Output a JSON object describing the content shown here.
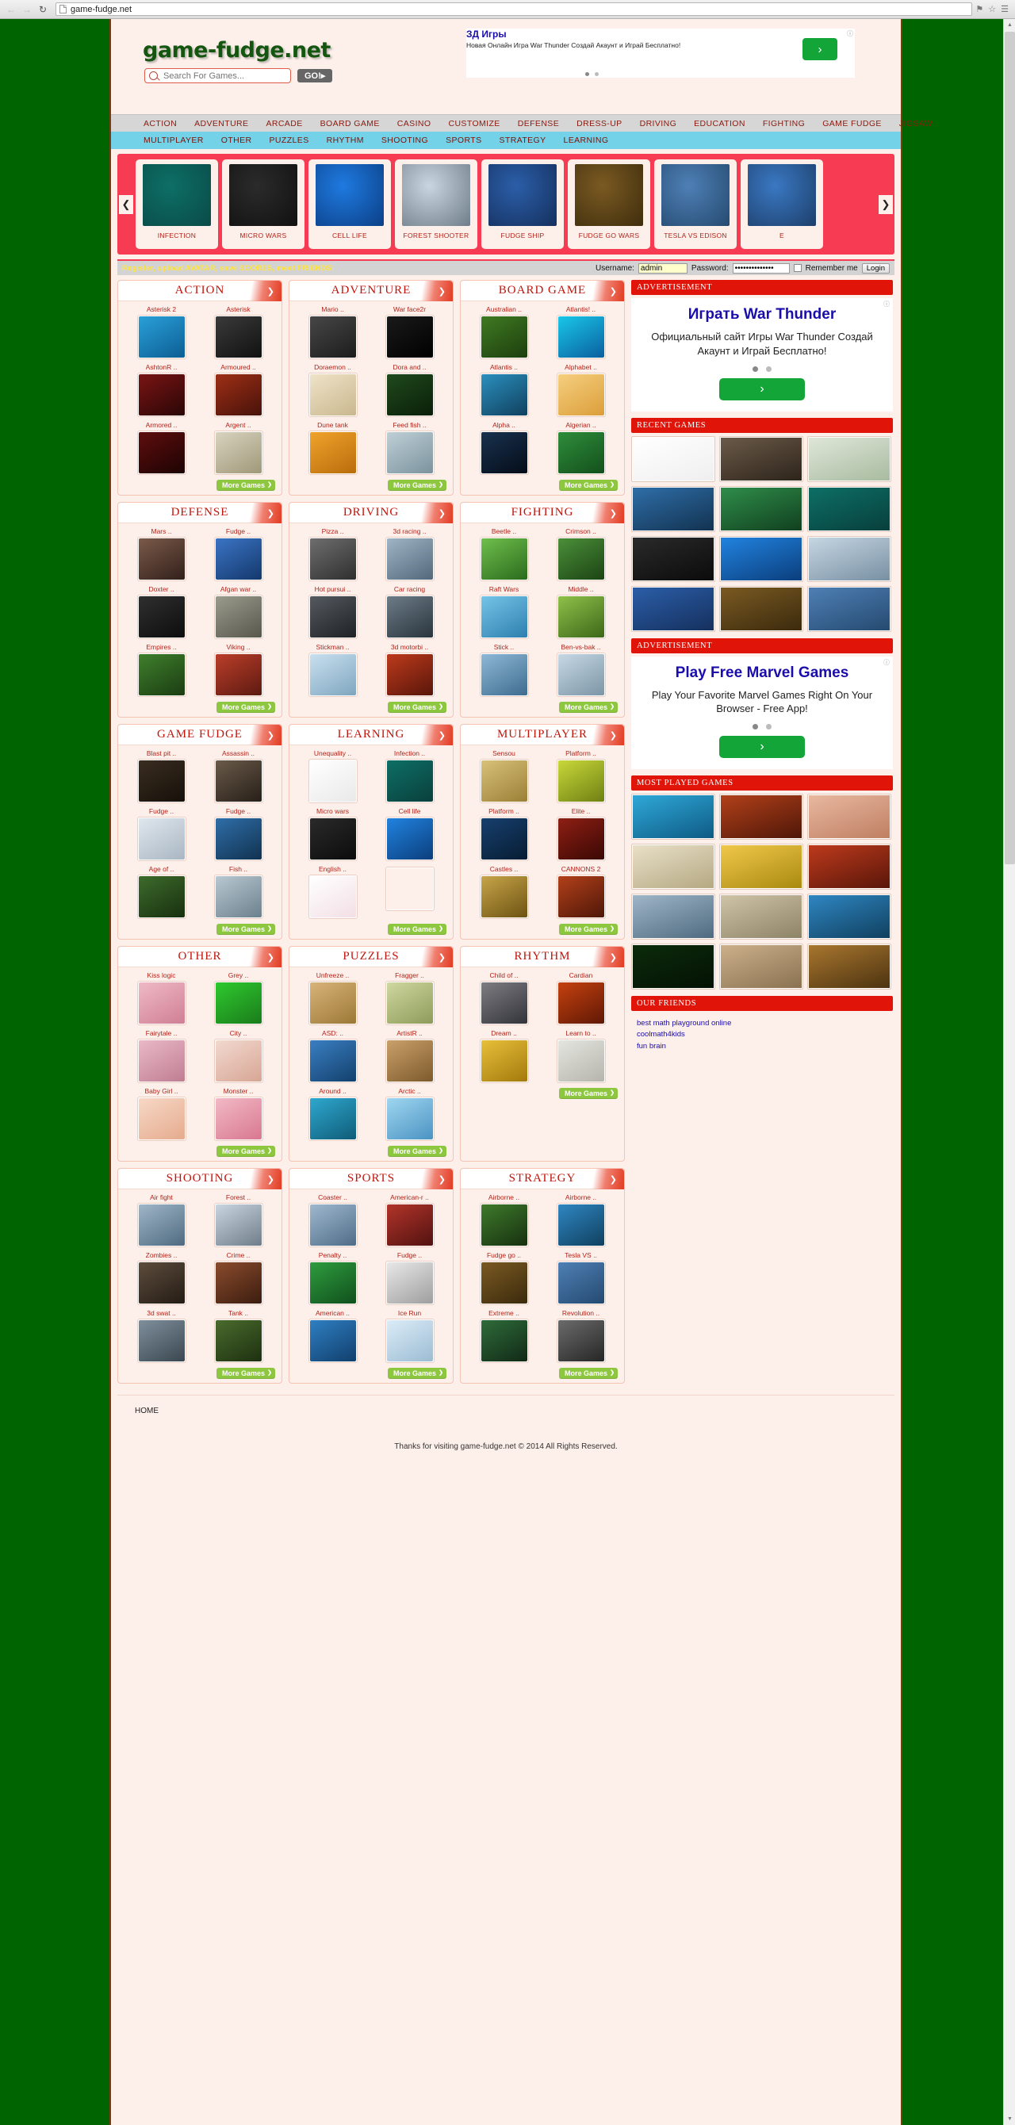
{
  "browser": {
    "url": "game-fudge.net",
    "back_icon": "back-arrow-icon",
    "forward_icon": "forward-arrow-icon",
    "reload_icon": "reload-icon",
    "page_icon": "page-icon",
    "right_icons": [
      "bookmark-icon",
      "star-icon",
      "menu-icon"
    ]
  },
  "header": {
    "logo": "game-fudge.net",
    "search_placeholder": "Search For Games...",
    "search_value": "",
    "go_label": "GO!▸"
  },
  "top_ad": {
    "title": "ЗД Игры",
    "body": "Новая Онлайн Игра War Thunder Создай Акаунт и Играй Бесплатно!",
    "cta": "›"
  },
  "nav_primary": [
    "ACTION",
    "ADVENTURE",
    "ARCADE",
    "BOARD GAME",
    "CASINO",
    "CUSTOMIZE",
    "DEFENSE",
    "DRESS-UP",
    "DRIVING",
    "EDUCATION",
    "FIGHTING",
    "GAME FUDGE",
    "JIGSAW"
  ],
  "nav_secondary": [
    "MULTIPLAYER",
    "OTHER",
    "PUZZLES",
    "RHYTHM",
    "SHOOTING",
    "SPORTS",
    "STRATEGY",
    "LEARNING"
  ],
  "carousel": {
    "prev_icon": "chevron-left-icon",
    "next_icon": "chevron-right-icon",
    "items": [
      {
        "label": "INFECTION",
        "c1": "#0d6f66",
        "c2": "#0a4a48"
      },
      {
        "label": "MICRO WARS",
        "c1": "#2b2b2b",
        "c2": "#111111"
      },
      {
        "label": "CELL LIFE",
        "c1": "#1f7ae0",
        "c2": "#0b3f86"
      },
      {
        "label": "FOREST SHOOTER",
        "c1": "#c9d6e0",
        "c2": "#6f7d8a"
      },
      {
        "label": "FUDGE SHIP",
        "c1": "#2b5ea8",
        "c2": "#15305e"
      },
      {
        "label": "FUDGE GO WARS",
        "c1": "#7a5a22",
        "c2": "#3f2d0d"
      },
      {
        "label": "TESLA VS EDISON",
        "c1": "#4e7fb5",
        "c2": "#254a70"
      },
      {
        "label": "E",
        "c1": "#3a78c2",
        "c2": "#1d3f6b"
      }
    ]
  },
  "loginbar": {
    "promo": "Register, upload AVATAR, save SCORES, meet FRIENDS!",
    "username_label": "Username:",
    "username_value": "admin",
    "password_label": "Password:",
    "password_value": "••••••••••••••",
    "remember_label": "Remember me",
    "login_label": "Login"
  },
  "more_label": "More Games",
  "categories": [
    {
      "title": "ACTION",
      "games": [
        {
          "name": "Asterisk 2",
          "c1": "#2aa0d8",
          "c2": "#0c5e93"
        },
        {
          "name": "Asterisk",
          "c1": "#3a3a3a",
          "c2": "#111111"
        },
        {
          "name": "AshtonR ..",
          "c1": "#7a1414",
          "c2": "#2a0606"
        },
        {
          "name": "Armoured ..",
          "c1": "#9e2f16",
          "c2": "#48120a"
        },
        {
          "name": "Armored ..",
          "c1": "#5f0d0d",
          "c2": "#1d0303"
        },
        {
          "name": "Argent ..",
          "c1": "#d8d3c0",
          "c2": "#a09878"
        }
      ]
    },
    {
      "title": "ADVENTURE",
      "games": [
        {
          "name": "Mario ..",
          "c1": "#474747",
          "c2": "#1c1c1c"
        },
        {
          "name": "War face2r",
          "c1": "#1a1a1a",
          "c2": "#000000"
        },
        {
          "name": "Doraemon ..",
          "c1": "#efe3c8",
          "c2": "#c9b78e"
        },
        {
          "name": "Dora and ..",
          "c1": "#1f4a1c",
          "c2": "#0a1f09"
        },
        {
          "name": "Dune tank",
          "c1": "#f0a32b",
          "c2": "#b96d0c"
        },
        {
          "name": "Feed fish ..",
          "c1": "#bfcfd6",
          "c2": "#7b939e"
        }
      ]
    },
    {
      "title": "BOARD GAME",
      "games": [
        {
          "name": "Australian ..",
          "c1": "#3f7a22",
          "c2": "#1d3e0e"
        },
        {
          "name": "Atlantis! ..",
          "c1": "#19c7e8",
          "c2": "#0a5f9e"
        },
        {
          "name": "Atlantis ..",
          "c1": "#2b8fbe",
          "c2": "#10405e"
        },
        {
          "name": "Alphabet ..",
          "c1": "#f5cf7f",
          "c2": "#dc9e3a"
        },
        {
          "name": "Alpha ..",
          "c1": "#18324f",
          "c2": "#050c18"
        },
        {
          "name": "Algerian ..",
          "c1": "#2f8d3b",
          "c2": "#13501c"
        }
      ]
    },
    {
      "title": "DEFENSE",
      "games": [
        {
          "name": "Mars ..",
          "c1": "#7a5a4a",
          "c2": "#32201a"
        },
        {
          "name": "Fudge ..",
          "c1": "#3b74c4",
          "c2": "#14386d"
        },
        {
          "name": "Doxter ..",
          "c1": "#2f2f2f",
          "c2": "#0d0d0d"
        },
        {
          "name": "Afgan war ..",
          "c1": "#9a9a8d",
          "c2": "#57574c"
        },
        {
          "name": "Empires ..",
          "c1": "#3f7f2d",
          "c2": "#1b3d12"
        },
        {
          "name": "Viking ..",
          "c1": "#bb3e2a",
          "c2": "#5d1a11"
        }
      ]
    },
    {
      "title": "DRIVING",
      "games": [
        {
          "name": "Pizza ..",
          "c1": "#6e6e6e",
          "c2": "#2f2f2f"
        },
        {
          "name": "3d racing ..",
          "c1": "#9fb4c5",
          "c2": "#53687a"
        },
        {
          "name": "Hot pursui ..",
          "c1": "#555a60",
          "c2": "#1e2125"
        },
        {
          "name": "Car racing",
          "c1": "#6c7c88",
          "c2": "#2a343c"
        },
        {
          "name": "Stickman ..",
          "c1": "#c9e0ef",
          "c2": "#7fa6bf"
        },
        {
          "name": "3d motorbi ..",
          "c1": "#bd3a1c",
          "c2": "#59160a"
        }
      ]
    },
    {
      "title": "FIGHTING",
      "games": [
        {
          "name": "Beetle ..",
          "c1": "#6fbf4d",
          "c2": "#2b6b1c"
        },
        {
          "name": "Crimson ..",
          "c1": "#4b8f3a",
          "c2": "#1c4413"
        },
        {
          "name": "Raft Wars",
          "c1": "#74c4e8",
          "c2": "#2e7fae"
        },
        {
          "name": "Middle ..",
          "c1": "#8fc04a",
          "c2": "#3d6818"
        },
        {
          "name": "Stick ..",
          "c1": "#8fb8d6",
          "c2": "#3e6c8f"
        },
        {
          "name": "Ben-vs-bak ..",
          "c1": "#c7d8e4",
          "c2": "#7c95a6"
        }
      ]
    },
    {
      "title": "GAME FUDGE",
      "games": [
        {
          "name": "Blast pit ..",
          "c1": "#3a2d20",
          "c2": "#16100a"
        },
        {
          "name": "Assassin ..",
          "c1": "#6a5a4a",
          "c2": "#271f18"
        },
        {
          "name": "Fudge ..",
          "c1": "#dfe7ee",
          "c2": "#a9b6c2"
        },
        {
          "name": "Fudge ..",
          "c1": "#2f6ea8",
          "c2": "#113250"
        },
        {
          "name": "Age of ..",
          "c1": "#3d6b2c",
          "c2": "#18300f"
        },
        {
          "name": "Fish ..",
          "c1": "#b9c8d2",
          "c2": "#6b808d"
        }
      ]
    },
    {
      "title": "LEARNING",
      "games": [
        {
          "name": "Unequality ..",
          "c1": "#ffffff",
          "c2": "#e9e9e9"
        },
        {
          "name": "Infection ..",
          "c1": "#0d6f66",
          "c2": "#0a3f3c"
        },
        {
          "name": "Micro wars",
          "c1": "#2a2a2a",
          "c2": "#0c0c0c"
        },
        {
          "name": "Cell life",
          "c1": "#2183df",
          "c2": "#0b3e7d"
        },
        {
          "name": "English ..",
          "c1": "#ffffff",
          "c2": "#f2dfe6"
        },
        {
          "name": "",
          "c1": "#fdefe9",
          "c2": "#fdefe9"
        }
      ]
    },
    {
      "title": "MULTIPLAYER",
      "games": [
        {
          "name": "Sensou",
          "c1": "#d8c17a",
          "c2": "#9b7f36"
        },
        {
          "name": "Platform ..",
          "c1": "#c8d83a",
          "c2": "#6f8013"
        },
        {
          "name": "Platform ..",
          "c1": "#17406e",
          "c2": "#071c33"
        },
        {
          "name": "Elite ..",
          "c1": "#8e1f14",
          "c2": "#3a0804"
        },
        {
          "name": "Castles ..",
          "c1": "#c8a54a",
          "c2": "#6d5312"
        },
        {
          "name": "CANNONS 2",
          "c1": "#b2401a",
          "c2": "#4f1708"
        }
      ]
    },
    {
      "title": "OTHER",
      "games": [
        {
          "name": "Kiss logic",
          "c1": "#efb9c6",
          "c2": "#cf7f94"
        },
        {
          "name": "Grey ..",
          "c1": "#2fc92f",
          "c2": "#1a7c1a"
        },
        {
          "name": "Fairytale ..",
          "c1": "#e9b9c8",
          "c2": "#c07d92"
        },
        {
          "name": "City ..",
          "c1": "#f2d9cf",
          "c2": "#d7a694"
        },
        {
          "name": "Baby Girl ..",
          "c1": "#f7d8c6",
          "c2": "#e5ab8e"
        },
        {
          "name": "Monster ..",
          "c1": "#f2b9c6",
          "c2": "#d8788f"
        }
      ]
    },
    {
      "title": "PUZZLES",
      "games": [
        {
          "name": "Unfreeze ..",
          "c1": "#d9b37a",
          "c2": "#9c7836"
        },
        {
          "name": "Fragger ..",
          "c1": "#cfd8a0",
          "c2": "#8e9a5a"
        },
        {
          "name": "ASD: ..",
          "c1": "#3a7fc2",
          "c2": "#13406d"
        },
        {
          "name": "ArtistR ..",
          "c1": "#caa06a",
          "c2": "#7d5a2c"
        },
        {
          "name": "Around ..",
          "c1": "#2fa8cf",
          "c2": "#0f5c78"
        },
        {
          "name": "Arctic ..",
          "c1": "#9fd6f0",
          "c2": "#4b93c3"
        }
      ]
    },
    {
      "title": "RHYTHM",
      "games": [
        {
          "name": "Child of ..",
          "c1": "#7d7d82",
          "c2": "#33333a"
        },
        {
          "name": "Cardian",
          "c1": "#c5410f",
          "c2": "#5f1805"
        },
        {
          "name": "Dream ..",
          "c1": "#e8c03a",
          "c2": "#a3790c"
        },
        {
          "name": "Learn to ..",
          "c1": "#e5e5e0",
          "c2": "#b5b5ac"
        }
      ]
    },
    {
      "title": "SHOOTING",
      "games": [
        {
          "name": "Air fight",
          "c1": "#9fb6c8",
          "c2": "#4f6a80"
        },
        {
          "name": "Forest ..",
          "c1": "#c9d6e0",
          "c2": "#6f7d8a"
        },
        {
          "name": "Zombies ..",
          "c1": "#5d4c3c",
          "c2": "#241c15"
        },
        {
          "name": "Crime ..",
          "c1": "#8a4b2d",
          "c2": "#3c1d0f"
        },
        {
          "name": "3d swat ..",
          "c1": "#7f8f9c",
          "c2": "#3a4750"
        },
        {
          "name": "Tank ..",
          "c1": "#4a6b2d",
          "c2": "#1d3010"
        }
      ]
    },
    {
      "title": "SPORTS",
      "games": [
        {
          "name": "Coaster ..",
          "c1": "#9fb8cf",
          "c2": "#4f6c87"
        },
        {
          "name": "American-r ..",
          "c1": "#b2342a",
          "c2": "#521210"
        },
        {
          "name": "Penalty ..",
          "c1": "#2f9c3f",
          "c2": "#10501c"
        },
        {
          "name": "Fudge ..",
          "c1": "#e8e8e8",
          "c2": "#9e9e9e"
        },
        {
          "name": "American ..",
          "c1": "#2f7fc2",
          "c2": "#113f6d"
        },
        {
          "name": "Ice Run",
          "c1": "#dcecf7",
          "c2": "#9bbcd4"
        }
      ]
    },
    {
      "title": "STRATEGY",
      "games": [
        {
          "name": "Airborne ..",
          "c1": "#3e7a2c",
          "c2": "#17300f"
        },
        {
          "name": "Airborne ..",
          "c1": "#2f86c2",
          "c2": "#10405f"
        },
        {
          "name": "Fudge go ..",
          "c1": "#7a5a22",
          "c2": "#3b2a0d"
        },
        {
          "name": "Tesla VS ..",
          "c1": "#4e7fb5",
          "c2": "#254a70"
        },
        {
          "name": "Extreme ..",
          "c1": "#2f6b3a",
          "c2": "#112a16"
        },
        {
          "name": "Revolution ..",
          "c1": "#6b6b6b",
          "c2": "#262626"
        }
      ]
    }
  ],
  "sidebar": {
    "ad1_header": "ADVERTISEMENT",
    "ad1": {
      "title": "Играть War Thunder",
      "body": "Официальный сайт Игры War Thunder Создай Акаунт и Играй Бесплатно!",
      "cta": "›"
    },
    "recent_header": "RECENT GAMES",
    "recent": [
      {
        "c1": "#ffffff",
        "c2": "#efefef"
      },
      {
        "c1": "#6b5a48",
        "c2": "#2d241b"
      },
      {
        "c1": "#dfe7d8",
        "c2": "#a8bba0"
      },
      {
        "c1": "#2f6ea8",
        "c2": "#123250"
      },
      {
        "c1": "#2f8d4a",
        "c2": "#11401f"
      },
      {
        "c1": "#0d6f66",
        "c2": "#083f3c"
      },
      {
        "c1": "#2a2a2a",
        "c2": "#0b0b0b"
      },
      {
        "c1": "#2183df",
        "c2": "#0b3e7d"
      },
      {
        "c1": "#c6d6e2",
        "c2": "#7890a3"
      },
      {
        "c1": "#2b5ea8",
        "c2": "#15305e"
      },
      {
        "c1": "#7a5a22",
        "c2": "#3b2a0d"
      },
      {
        "c1": "#4e7fb5",
        "c2": "#254a70"
      }
    ],
    "ad2_header": "ADVERTISEMENT",
    "ad2": {
      "title": "Play Free Marvel Games",
      "body": "Play Your Favorite Marvel Games Right On Your Browser - Free App!",
      "cta": "›"
    },
    "most_header": "MOST PLAYED GAMES",
    "most": [
      {
        "c1": "#2fa8d8",
        "c2": "#0e5b84"
      },
      {
        "c1": "#b2401a",
        "c2": "#4f1708"
      },
      {
        "c1": "#e8b8a0",
        "c2": "#bf7f62"
      },
      {
        "c1": "#e8e0c8",
        "c2": "#b5a882"
      },
      {
        "c1": "#f0c84a",
        "c2": "#a98a10"
      },
      {
        "c1": "#bd3a1c",
        "c2": "#59160a"
      },
      {
        "c1": "#9fb6c8",
        "c2": "#4f6a80"
      },
      {
        "c1": "#cfc3a8",
        "c2": "#8d8367"
      },
      {
        "c1": "#2f86c2",
        "c2": "#10405f"
      },
      {
        "c1": "#0b2b0b",
        "c2": "#041104"
      },
      {
        "c1": "#cbb08a",
        "c2": "#8a7151"
      },
      {
        "c1": "#a8762f",
        "c2": "#4d3310"
      }
    ],
    "friends_header": "OUR FRIENDS",
    "friends": [
      "best math playground online",
      "coolmath4kids",
      "fun brain"
    ]
  },
  "footer": {
    "home": "HOME",
    "credit": "Thanks for visiting game-fudge.net © 2014 All Rights Reserved."
  }
}
